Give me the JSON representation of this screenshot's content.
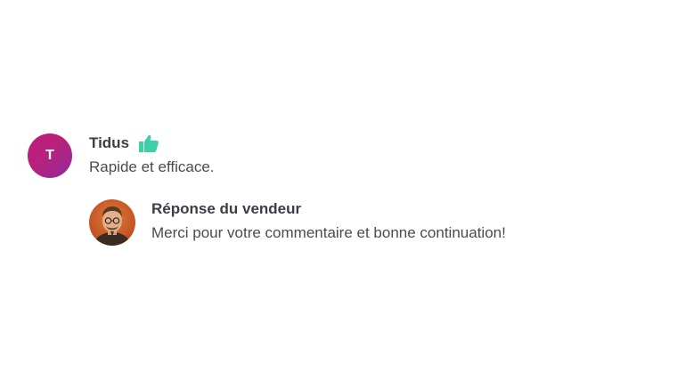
{
  "review": {
    "avatar_letter": "T",
    "author": "Tidus",
    "rating_icon": "thumbs-up-icon",
    "text": "Rapide et efficace."
  },
  "seller_reply": {
    "avatar": "seller-avatar-photo",
    "title": "Réponse du vendeur",
    "text": "Merci pour votre commentaire et bonne continuation!"
  },
  "colors": {
    "avatar_gradient_start": "#c2187f",
    "avatar_gradient_end": "#8f2a9e",
    "thumb_icon": "#3fcfa8",
    "text": "#3d3d48"
  }
}
